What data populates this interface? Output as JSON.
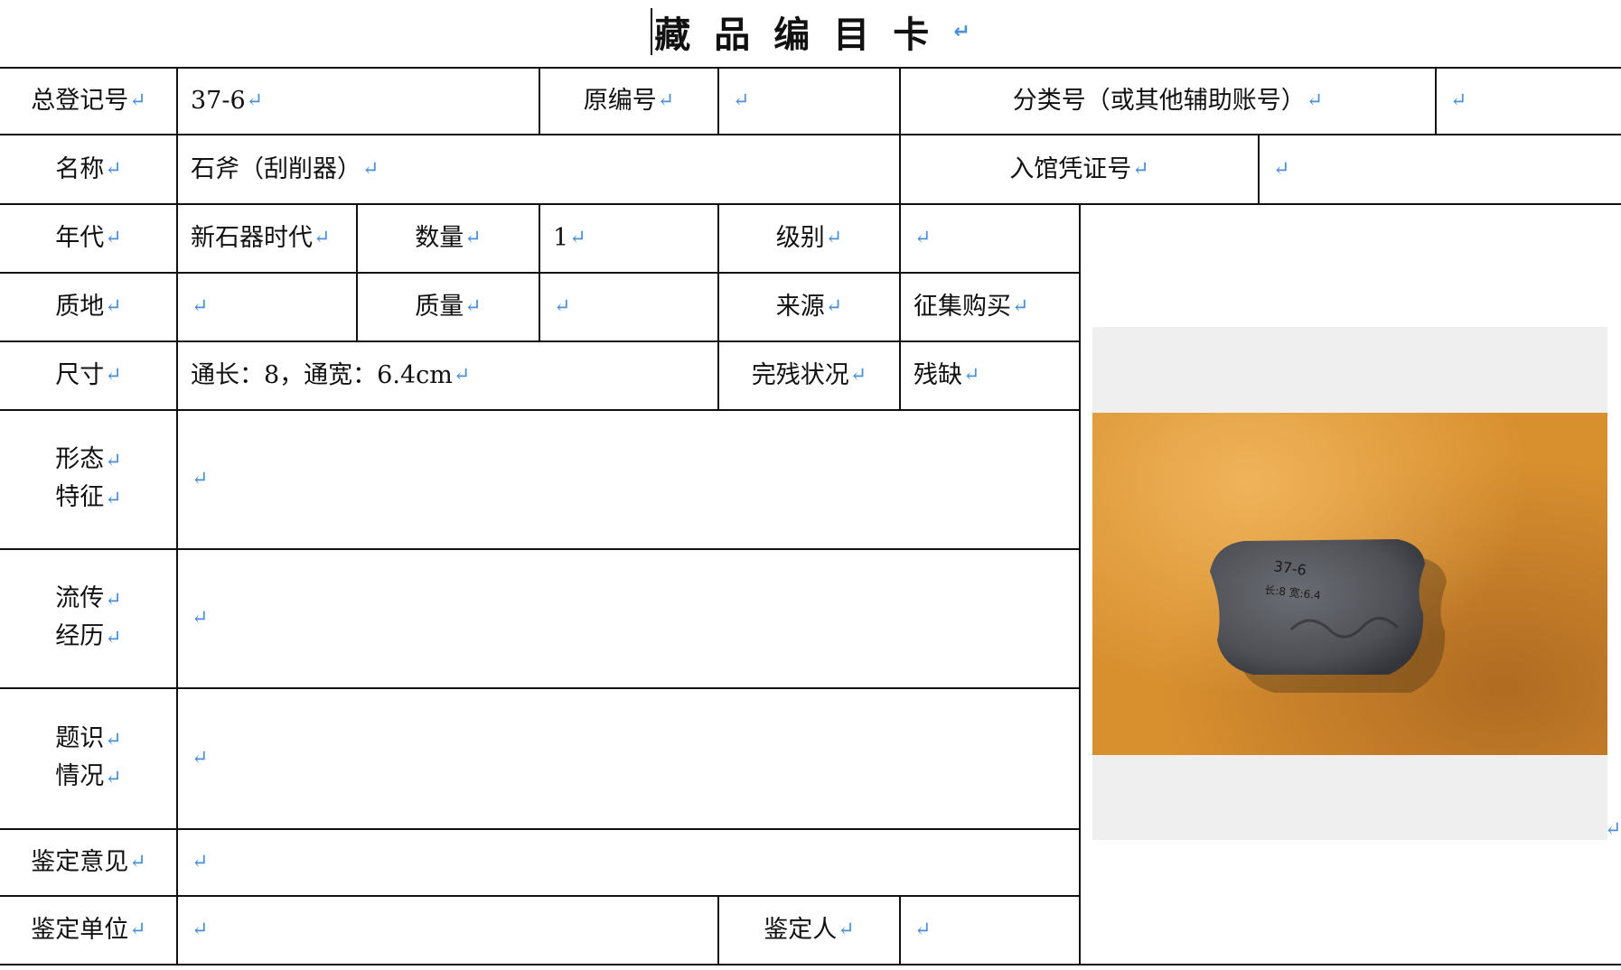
{
  "card": {
    "title": "藏品编目卡",
    "enter_mark": "↵",
    "fields": {
      "total_reg_no": {
        "label": "总登记号",
        "value": "37-6"
      },
      "original_no": {
        "label": "原编号",
        "value": ""
      },
      "class_no": {
        "label": "分类号（或其他辅助账号）",
        "value": ""
      },
      "name": {
        "label": "名称",
        "value": "石斧（刮削器）"
      },
      "voucher_no": {
        "label": "入馆凭证号",
        "value": ""
      },
      "era": {
        "label": "年代",
        "value": "新石器时代"
      },
      "quantity": {
        "label": "数量",
        "value": "1"
      },
      "grade": {
        "label": "级别",
        "value": ""
      },
      "material": {
        "label": "质地",
        "value": ""
      },
      "mass": {
        "label": "质量",
        "value": ""
      },
      "source": {
        "label": "来源",
        "value": "征集购买"
      },
      "size": {
        "label": "尺寸",
        "value": "通长：8，通宽：6.4cm"
      },
      "condition": {
        "label": "完残状况",
        "value": "残缺"
      },
      "form": {
        "label_1": "形态",
        "label_2": "特征",
        "value": ""
      },
      "provenance": {
        "label_1": "流传",
        "label_2": "经历",
        "value": ""
      },
      "inscription": {
        "label_1": "题识",
        "label_2": "情况",
        "value": ""
      },
      "appraisal": {
        "label": "鉴定意见",
        "value": ""
      },
      "appraisal_org": {
        "label": "鉴定单位",
        "value": ""
      },
      "appraiser": {
        "label": "鉴定人",
        "value": ""
      }
    },
    "photo": {
      "caption": "37-6",
      "line_2": "长:8 宽:6.4",
      "colors": {
        "background": "#d8902f",
        "stone": "#54565c",
        "frame": "#efefef"
      }
    },
    "colors": {
      "enter_mark": "#4a90d9",
      "border": "#111111"
    }
  }
}
